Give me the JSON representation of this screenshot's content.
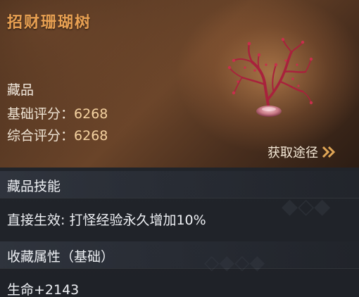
{
  "item": {
    "name": "招财珊瑚树",
    "category": "藏品"
  },
  "scores": {
    "base_label": "基础评分：",
    "base_value": "6268",
    "total_label": "综合评分：",
    "total_value": "6268"
  },
  "acquire": {
    "label": "获取途径",
    "icon": "double-chevron-right-icon"
  },
  "skill_section": {
    "title": "藏品技能",
    "effect": "直接生效: 打怪经验永久增加10%"
  },
  "attr_section": {
    "title": "收藏属性（基础）",
    "hp": "生命+2143"
  },
  "colors": {
    "title": "#e8a052",
    "accent": "#e0a656",
    "coral": "#b0253e"
  }
}
